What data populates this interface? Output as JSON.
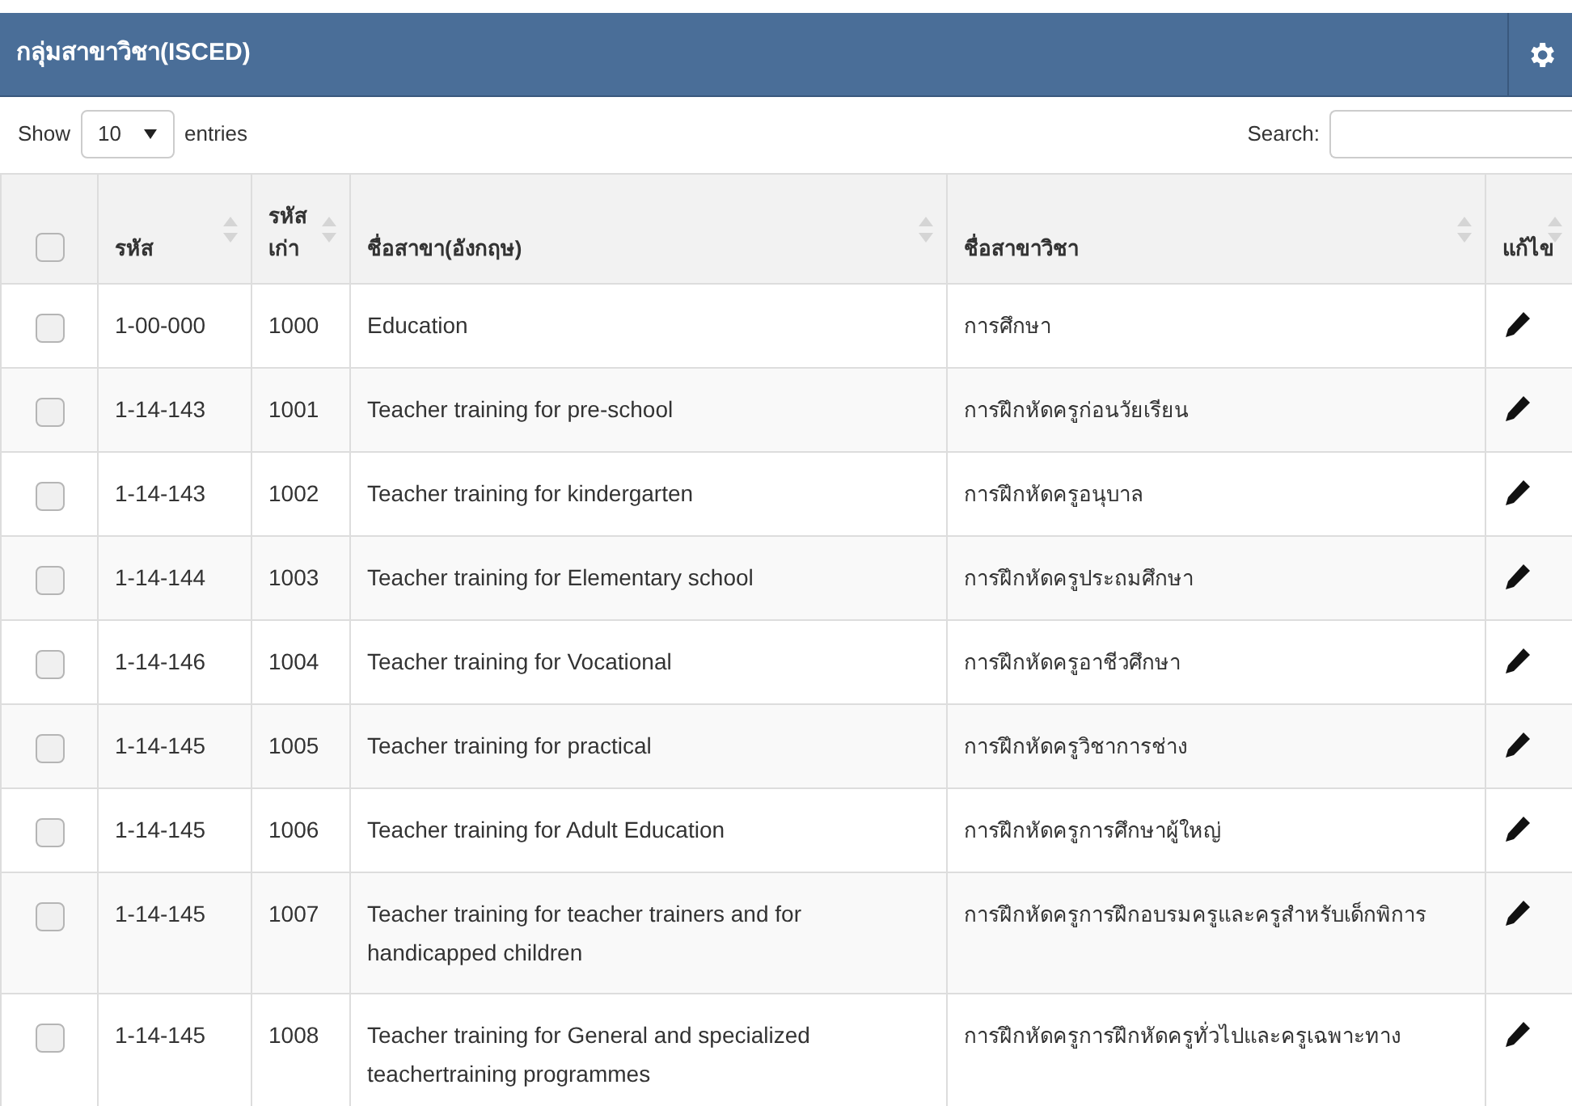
{
  "panel": {
    "title": "กลุ่มสาขาวิชา(ISCED)"
  },
  "length_control": {
    "prefix": "Show",
    "value": "10",
    "suffix": "entries"
  },
  "search": {
    "label": "Search:"
  },
  "table": {
    "select_all": {
      "checked": false
    },
    "columns": [
      {
        "label": "รหัส",
        "sortable": true
      },
      {
        "label": "รหัส เก่า",
        "sortable": true
      },
      {
        "label": "ชื่อสาขา(อังกฤษ)",
        "sortable": true
      },
      {
        "label": "ชื่อสาขาวิชา",
        "sortable": true
      },
      {
        "label": "แก้ไข",
        "sortable": true
      }
    ],
    "rows": [
      {
        "checked": false,
        "code": "1-00-000",
        "old_code": "1000",
        "name_en": "Education",
        "name_th": "การศึกษา"
      },
      {
        "checked": false,
        "code": "1-14-143",
        "old_code": "1001",
        "name_en": "Teacher training for pre-school",
        "name_th": "การฝึกหัดครูก่อนวัยเรียน"
      },
      {
        "checked": false,
        "code": "1-14-143",
        "old_code": "1002",
        "name_en": "Teacher training for kindergarten",
        "name_th": "การฝึกหัดครูอนุบาล"
      },
      {
        "checked": false,
        "code": "1-14-144",
        "old_code": "1003",
        "name_en": "Teacher training for Elementary school",
        "name_th": "การฝึกหัดครูประถมศึกษา"
      },
      {
        "checked": false,
        "code": "1-14-146",
        "old_code": "1004",
        "name_en": "Teacher training for Vocational",
        "name_th": "การฝึกหัดครูอาชีวศึกษา"
      },
      {
        "checked": false,
        "code": "1-14-145",
        "old_code": "1005",
        "name_en": "Teacher training for practical",
        "name_th": "การฝึกหัดครูวิชาการช่าง"
      },
      {
        "checked": false,
        "code": "1-14-145",
        "old_code": "1006",
        "name_en": "Teacher training for Adult Education",
        "name_th": "การฝึกหัดครูการศึกษาผู้ใหญ่"
      },
      {
        "checked": false,
        "code": "1-14-145",
        "old_code": "1007",
        "name_en": "Teacher training for teacher trainers and for handicapped children",
        "name_th": "การฝึกหัดครูการฝึกอบรมครูและครูสำหรับเด็กพิการ"
      },
      {
        "checked": false,
        "code": "1-14-145",
        "old_code": "1008",
        "name_en": "Teacher training for General and specialized teachertraining programmes",
        "name_th": "การฝึกหัดครูการฝึกหัดครูทั่วไปและครูเฉพาะทาง"
      }
    ]
  }
}
